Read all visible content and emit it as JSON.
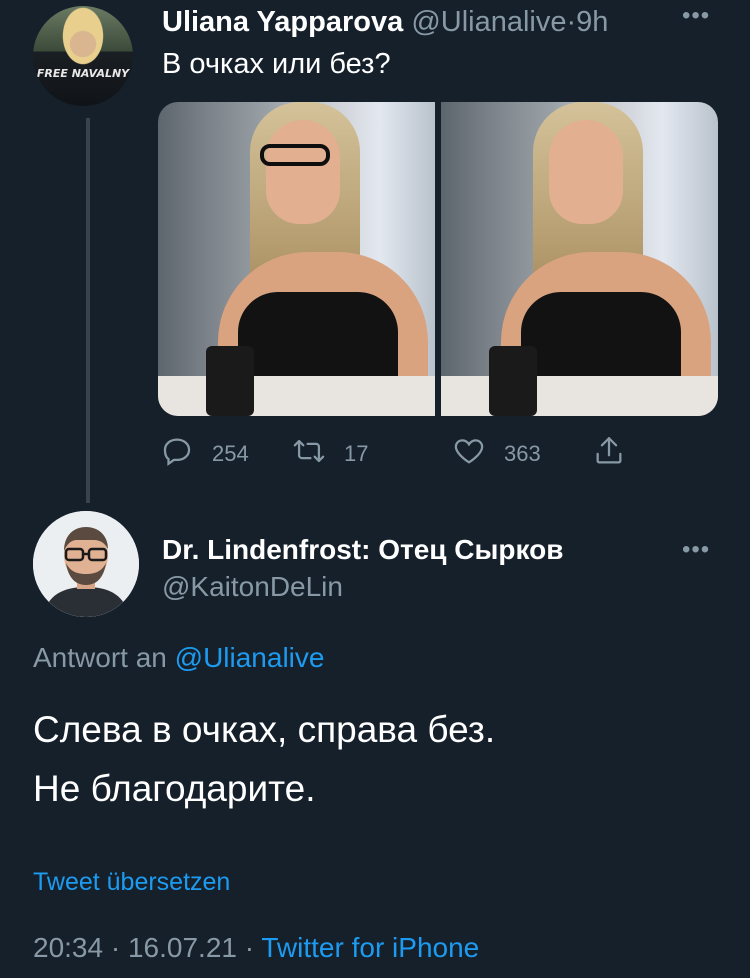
{
  "parent_tweet": {
    "display_name": "Uliana Yapparova",
    "handle": "@Ulianalive",
    "separator": "·",
    "time": "9h",
    "text": "В очках или без?",
    "avatar_shirt_text": "FREE NAVALNY",
    "media": [
      {
        "icon": "photo-with-glasses"
      },
      {
        "icon": "photo-without-glasses"
      }
    ],
    "actions": {
      "replies": "254",
      "retweets": "17",
      "likes": "363"
    }
  },
  "reply_tweet": {
    "display_name": "Dr. Lindenfrost: Отец Сырков",
    "handle": "@KaitonDeLin",
    "reply_context_prefix": "Antwort an",
    "reply_context_handle": "@Ulianalive",
    "text_line1": "Слева в очках, справа без.",
    "text_line2": "Не благодарите.",
    "translate_label": "Tweet übersetzen",
    "time": "20:34",
    "date": "16.07.21",
    "meta_separator": "·",
    "source": "Twitter for iPhone"
  },
  "colors": {
    "background": "#15202b",
    "text_primary": "#ffffff",
    "text_secondary": "#8899a6",
    "accent": "#1d9bf0",
    "thread_line": "#38444d"
  }
}
